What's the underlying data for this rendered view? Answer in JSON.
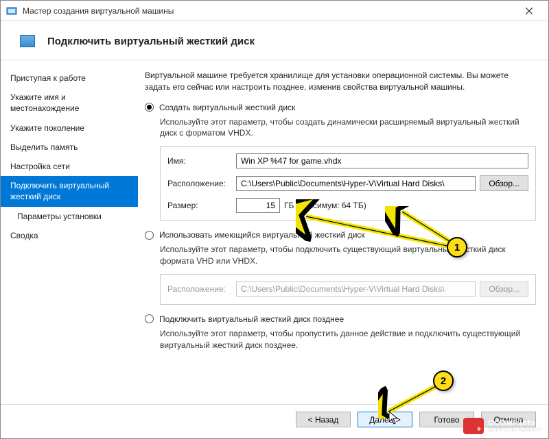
{
  "titlebar": {
    "title": "Мастер создания виртуальной машины"
  },
  "header": {
    "title": "Подключить виртуальный жесткий диск"
  },
  "sidebar": {
    "items": [
      {
        "label": "Приступая к работе"
      },
      {
        "label": "Укажите имя и местонахождение"
      },
      {
        "label": "Укажите поколение"
      },
      {
        "label": "Выделить память"
      },
      {
        "label": "Настройка сети"
      },
      {
        "label": "Подключить виртуальный жесткий диск"
      },
      {
        "label": "Параметры установки"
      },
      {
        "label": "Сводка"
      }
    ]
  },
  "content": {
    "intro": "Виртуальной машине требуется хранилище для установки операционной системы. Вы можете задать его сейчас или настроить позднее, изменив свойства виртуальной машины.",
    "opt1": {
      "label": "Создать виртуальный жесткий диск",
      "desc": "Используйте этот параметр, чтобы создать динамически расширяемый виртуальный жесткий диск с форматом VHDX.",
      "name_label": "Имя:",
      "name_value": "Win XP %47 for game.vhdx",
      "loc_label": "Расположение:",
      "loc_value": "C:\\Users\\Public\\Documents\\Hyper-V\\Virtual Hard Disks\\",
      "browse": "Обзор...",
      "size_label": "Размер:",
      "size_value": "15",
      "size_unit": "ГБ (максимум: 64 ТБ)"
    },
    "opt2": {
      "label": "Использовать имеющийся виртуальный жесткий диск",
      "desc": "Используйте этот параметр, чтобы подключить существующий виртуальный жесткий диск формата VHD или VHDX.",
      "loc_label": "Расположение:",
      "loc_value": "C:\\Users\\Public\\Documents\\Hyper-V\\Virtual Hard Disks\\",
      "browse": "Обзор..."
    },
    "opt3": {
      "label": "Подключить виртуальный жесткий диск позднее",
      "desc": "Используйте этот параметр, чтобы пропустить данное действие и подключить существующий виртуальный жесткий диск позднее."
    }
  },
  "footer": {
    "back": "< Назад",
    "next": "Далее >",
    "finish": "Готово",
    "cancel": "Отмена"
  },
  "annotation": {
    "n1": "1",
    "n2": "2"
  },
  "watermark": {
    "l1": "OCOMP.info",
    "l2": "ВОПРОСЫ АДМИНУ"
  },
  "colors": {
    "accent": "#0078d7",
    "arrow": "#f2e400",
    "arrow_stroke": "#000"
  }
}
